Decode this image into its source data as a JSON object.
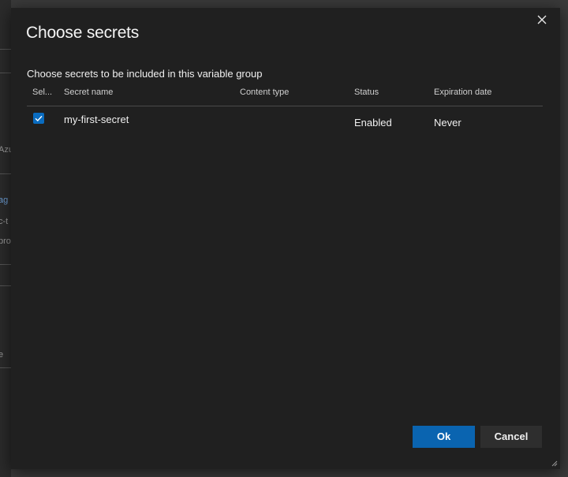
{
  "background": {
    "fragments": [
      {
        "text": "Azu",
        "link": false
      },
      {
        "text": "ag",
        "link": true
      },
      {
        "text": "c-t",
        "link": false
      },
      {
        "text": "pro",
        "link": false
      },
      {
        "text": "e",
        "link": false
      }
    ]
  },
  "dialog": {
    "title": "Choose secrets",
    "subtitle": "Choose secrets to be included in this variable group",
    "close_icon": "close-icon",
    "columns": {
      "select": "Sel...",
      "name": "Secret name",
      "content_type": "Content type",
      "status": "Status",
      "expiration": "Expiration date"
    },
    "rows": [
      {
        "selected": true,
        "name": "my-first-secret",
        "content_type": "",
        "status": "Enabled",
        "expiration": "Never"
      }
    ],
    "ok_label": "Ok",
    "cancel_label": "Cancel"
  },
  "colors": {
    "dialog_bg": "#202020",
    "accent": "#0a64b0",
    "checkbox": "#0a6cc0"
  }
}
